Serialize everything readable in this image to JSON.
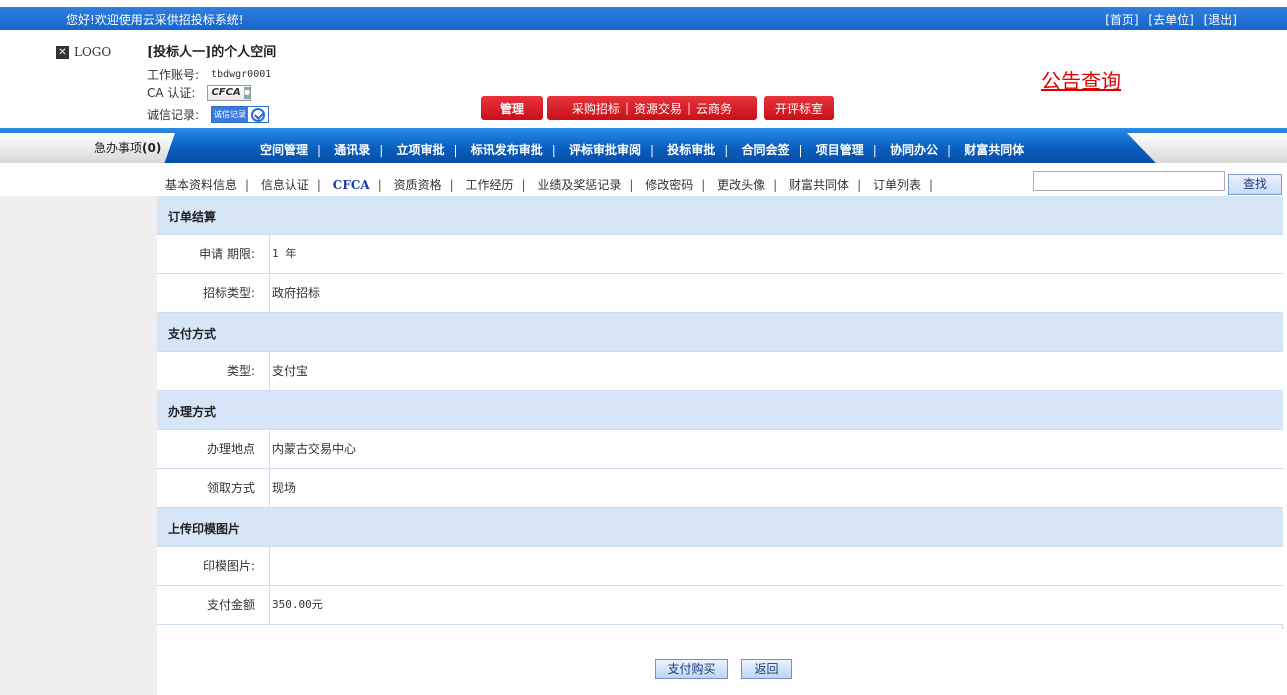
{
  "topbar": {
    "welcome": "您好!欢迎使用云采供招投标系统!",
    "links": [
      "[首页]",
      "[去单位]",
      "[退出]"
    ]
  },
  "header": {
    "logo_text": "LOGO",
    "space_title": "[投标人一]的个人空间",
    "account_label": "工作账号:",
    "account_value": "tbdwgr0001",
    "ca_label": "CA 认证:",
    "ca_badge": "CFCA",
    "credit_label": "诚信记录:",
    "credit_badge": "诚信记录",
    "notice_link": "公告查询",
    "manage_button": "管理",
    "group_buttons": [
      "采购招标",
      "资源交易",
      "云商务"
    ],
    "open_room_button": "开评标室"
  },
  "nav": {
    "urgent_label": "急办事项",
    "urgent_count": "(0)",
    "items": [
      "空间管理",
      "通讯录",
      "立项审批",
      "标讯发布审批",
      "评标审批审阅",
      "投标审批",
      "合同会签",
      "项目管理",
      "协同办公",
      "财富共同体"
    ]
  },
  "subnav": {
    "items": [
      "基本资料信息",
      "信息认证",
      "CFCA",
      "资质资格",
      "工作经历",
      "业绩及奖惩记录",
      "修改密码",
      "更改头像",
      "财富共同体",
      "订单列表"
    ],
    "active": "CFCA",
    "search_button": "查找",
    "search_value": ""
  },
  "order": {
    "sec_settlement": "订单结算",
    "period_label": "申请 期限:",
    "period_value": "1 年",
    "tender_type_label": "招标类型:",
    "tender_type_value": "政府招标",
    "sec_payment": "支付方式",
    "pay_type_label": "类型:",
    "pay_type_value": "支付宝",
    "sec_handling": "办理方式",
    "place_label": "办理地点",
    "place_value": "内蒙古交易中心",
    "pickup_label": "领取方式",
    "pickup_value": "现场",
    "sec_upload": "上传印模图片",
    "seal_image_label": "印模图片:",
    "seal_image_value": "",
    "amount_label": "支付金额",
    "amount_value": "350.00元",
    "pay_button": "支付购买",
    "back_button": "返回"
  },
  "colors": {
    "topbar_blue": "#1f6fd6",
    "nav_blue": "#0b5fc0",
    "accent_red": "#d8121c",
    "notice_red": "#e00000",
    "section_bg": "#d6e6f7"
  }
}
